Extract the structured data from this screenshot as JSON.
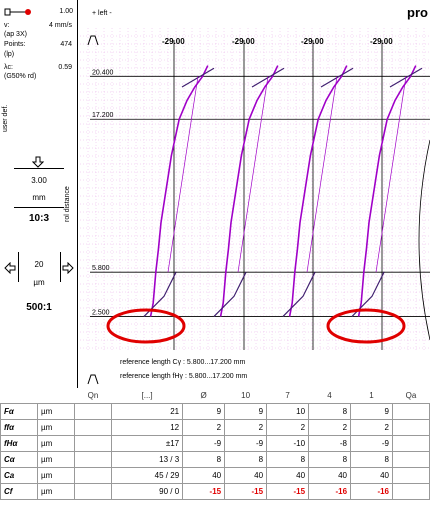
{
  "left_panel": {
    "probe_value": "1.00",
    "params": [
      {
        "label": "v:",
        "value": "4 mm/s"
      },
      {
        "label": "(ap 3X)",
        "value": ""
      },
      {
        "label": "Points:",
        "value": "474"
      },
      {
        "label": "(lp)",
        "value": ""
      },
      {
        "label": "λc:",
        "value": "0.59"
      },
      {
        "label": "(G50% rd)",
        "value": ""
      }
    ],
    "user_def": "user def.",
    "roll_distance": "rol distance",
    "vscale": {
      "value": "3.00",
      "unit": "mm",
      "ratio": "10:3"
    },
    "hscale": {
      "value": "20",
      "unit": "µm",
      "ratio": "500:1"
    }
  },
  "header": {
    "left_label": "+ left -",
    "title": "pro"
  },
  "chart_data": {
    "type": "line",
    "title": "",
    "column_values": [
      "-29.00",
      "-29.00",
      "-29.00",
      "-29.00"
    ],
    "y_ticks": [
      20.4,
      17.2,
      5.8,
      2.5
    ],
    "y_tick_labels": [
      "20.400",
      "17.200",
      "5.800",
      "2.500"
    ],
    "ylim": [
      0.0,
      24.0
    ],
    "reference_lines": [
      "reference length  Cγ : 5.800...17.200 mm",
      "reference length  fHγ : 5.800...17.200 mm"
    ],
    "series": [
      {
        "profile": 1,
        "x_offset_um": [
          -18,
          -16,
          -14,
          -12,
          -10,
          -6,
          -2,
          4,
          10,
          16,
          22,
          26
        ],
        "y_mm": [
          2.5,
          3.5,
          5.8,
          7.5,
          9.5,
          12.0,
          14.5,
          17.2,
          18.6,
          19.6,
          20.4,
          21.2
        ]
      },
      {
        "profile": 2,
        "x_offset_um": [
          -18,
          -16,
          -14,
          -12,
          -10,
          -6,
          -2,
          4,
          10,
          16,
          22,
          26
        ],
        "y_mm": [
          2.5,
          3.5,
          5.8,
          7.5,
          9.5,
          12.0,
          14.5,
          17.2,
          18.6,
          19.6,
          20.4,
          21.2
        ]
      },
      {
        "profile": 3,
        "x_offset_um": [
          -18,
          -16,
          -14,
          -12,
          -10,
          -6,
          -2,
          4,
          10,
          16,
          22,
          26
        ],
        "y_mm": [
          2.5,
          3.5,
          5.8,
          7.5,
          9.5,
          12.0,
          14.5,
          17.2,
          18.6,
          19.6,
          20.4,
          21.2
        ]
      },
      {
        "profile": 4,
        "x_offset_um": [
          -18,
          -16,
          -14,
          -12,
          -10,
          -6,
          -2,
          4,
          10,
          16,
          22,
          26
        ],
        "y_mm": [
          2.5,
          3.5,
          5.8,
          7.5,
          9.5,
          12.0,
          14.5,
          17.2,
          18.6,
          19.6,
          20.4,
          21.2
        ]
      }
    ],
    "colors": {
      "curve": "#a000c8",
      "curve_dark": "#402070",
      "grid": "#e8b0e8",
      "highlight": "#e00000"
    }
  },
  "table": {
    "header": [
      "Qn",
      "[...]",
      "Ø",
      "10",
      "7",
      "4",
      "1",
      "Qa"
    ],
    "rows": [
      {
        "label": "Fα",
        "unit": "µm",
        "nominal": "21",
        "values": [
          "9",
          "9",
          "10",
          "8",
          "9"
        ],
        "red": false
      },
      {
        "label": "ffα",
        "unit": "µm",
        "nominal": "12",
        "values": [
          "2",
          "2",
          "2",
          "2",
          "2"
        ],
        "red": false
      },
      {
        "label": "fHα",
        "unit": "µm",
        "nominal": "±17",
        "values": [
          "-9",
          "-9",
          "-10",
          "-8",
          "-9"
        ],
        "red": false
      },
      {
        "label": "Cα",
        "unit": "µm",
        "nominal": "13 / 3",
        "values": [
          "8",
          "8",
          "8",
          "8",
          "8"
        ],
        "red": false
      },
      {
        "label": "Ca",
        "unit": "µm",
        "nominal": "45 / 29",
        "values": [
          "40",
          "40",
          "40",
          "40",
          "40"
        ],
        "red": false
      },
      {
        "label": "Cf",
        "unit": "µm",
        "nominal": "90 / 0",
        "values": [
          "-15",
          "-15",
          "-15",
          "-16",
          "-16"
        ],
        "red": true
      }
    ]
  }
}
